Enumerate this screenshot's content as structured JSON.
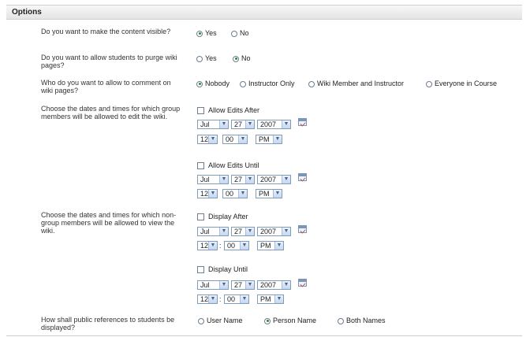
{
  "header": {
    "title": "Options"
  },
  "q1": {
    "label": "Do you want to make the content visible?",
    "options": [
      "Yes",
      "No"
    ],
    "selected": "Yes"
  },
  "q2": {
    "label": "Do you want to allow students to purge wiki pages?",
    "options": [
      "Yes",
      "No"
    ],
    "selected": "No"
  },
  "q3": {
    "label": "Who do you want to allow to comment on wiki pages?",
    "options": [
      "Nobody",
      "Instructor Only",
      "Wiki Member and Instructor",
      "Everyone in Course"
    ],
    "selected": "Nobody"
  },
  "q4": {
    "label": "Choose the dates and times for which group members will be allowed to edit the wiki."
  },
  "q5": {
    "label": "Choose the dates and times for which non-group members will be allowed to view the wiki."
  },
  "q6": {
    "label": "How shall public references to students be displayed?",
    "options": [
      "User Name",
      "Person Name",
      "Both Names"
    ],
    "selected": "Person Name"
  },
  "date_blocks": [
    {
      "label": "Allow Edits After",
      "checked": false,
      "month": "Jul",
      "day": "27",
      "year": "2007",
      "hour": "12",
      "minute": "00",
      "ampm": "PM"
    },
    {
      "label": "Allow Edits Until",
      "checked": false,
      "month": "Jul",
      "day": "27",
      "year": "2007",
      "hour": "12",
      "minute": "00",
      "ampm": "PM"
    },
    {
      "label": "Display After",
      "checked": false,
      "month": "Jul",
      "day": "27",
      "year": "2007",
      "hour": "12",
      "minute": "00",
      "ampm": "PM"
    },
    {
      "label": "Display Until",
      "checked": false,
      "month": "Jul",
      "day": "27",
      "year": "2007",
      "hour": "12",
      "minute": "00",
      "ampm": "PM"
    }
  ],
  "time_separator": ":",
  "icons": {
    "dropdown": "chevron-down-icon",
    "calendar": "calendar-icon"
  },
  "colors": {
    "header_bg": "#e8e8e8",
    "select_border": "#7f9db9",
    "radio_dot": "#2a8a2a"
  }
}
